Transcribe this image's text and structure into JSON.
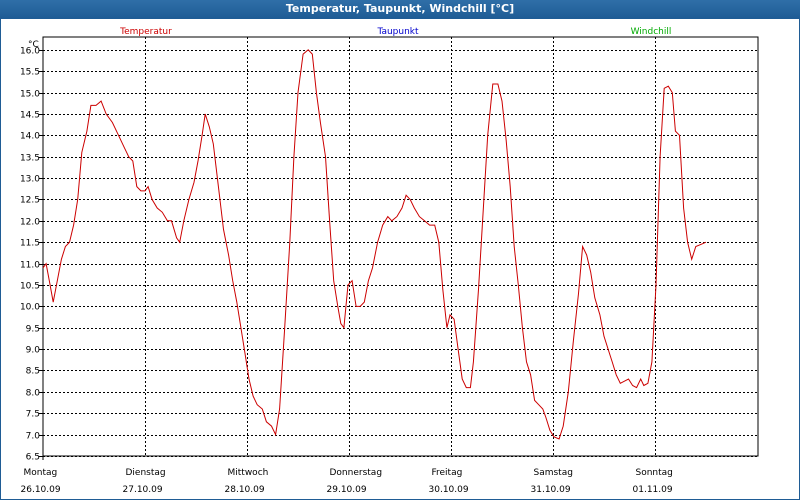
{
  "window": {
    "title": "Temperatur, Taupunkt, Windchill [°C]"
  },
  "colors": {
    "temperature": "#cc0000",
    "dewpoint": "#0000cc",
    "windchill": "#00aa00",
    "titlebar": "#1f5c95"
  },
  "chart_data": {
    "type": "line",
    "title": "Temperatur, Taupunkt, Windchill [°C]",
    "ylabel": "°C",
    "ylim": [
      6.5,
      16.3
    ],
    "yticks": [
      6.5,
      7.0,
      7.5,
      8.0,
      8.5,
      9.0,
      9.5,
      10.0,
      10.5,
      11.0,
      11.5,
      12.0,
      12.5,
      13.0,
      13.5,
      14.0,
      14.5,
      15.0,
      15.5,
      16.0
    ],
    "xlim": [
      0,
      7
    ],
    "grid": true,
    "legend_placement": "top",
    "day_labels": [
      {
        "weekday": "Montag",
        "date": "26.10.09"
      },
      {
        "weekday": "Dienstag",
        "date": "27.10.09"
      },
      {
        "weekday": "Mittwoch",
        "date": "28.10.09"
      },
      {
        "weekday": "Donnerstag",
        "date": "29.10.09"
      },
      {
        "weekday": "Freitag",
        "date": "30.10.09"
      },
      {
        "weekday": "Samstag",
        "date": "31.10.09"
      },
      {
        "weekday": "Sonntag",
        "date": "01.11.09"
      }
    ],
    "series": [
      {
        "name": "Temperatur",
        "color": "#cc0000",
        "points": [
          [
            0.0,
            10.9
          ],
          [
            0.03,
            11.0
          ],
          [
            0.07,
            10.5
          ],
          [
            0.1,
            10.1
          ],
          [
            0.14,
            10.6
          ],
          [
            0.18,
            11.1
          ],
          [
            0.22,
            11.4
          ],
          [
            0.26,
            11.5
          ],
          [
            0.3,
            11.9
          ],
          [
            0.34,
            12.5
          ],
          [
            0.38,
            13.6
          ],
          [
            0.43,
            14.1
          ],
          [
            0.47,
            14.7
          ],
          [
            0.52,
            14.7
          ],
          [
            0.57,
            14.8
          ],
          [
            0.62,
            14.5
          ],
          [
            0.68,
            14.3
          ],
          [
            0.74,
            14.0
          ],
          [
            0.8,
            13.7
          ],
          [
            0.84,
            13.5
          ],
          [
            0.88,
            13.4
          ],
          [
            0.92,
            12.8
          ],
          [
            0.96,
            12.7
          ],
          [
            1.0,
            12.7
          ],
          [
            1.03,
            12.8
          ],
          [
            1.07,
            12.5
          ],
          [
            1.12,
            12.3
          ],
          [
            1.17,
            12.2
          ],
          [
            1.22,
            12.0
          ],
          [
            1.26,
            12.0
          ],
          [
            1.31,
            11.6
          ],
          [
            1.34,
            11.5
          ],
          [
            1.38,
            12.0
          ],
          [
            1.43,
            12.5
          ],
          [
            1.48,
            12.9
          ],
          [
            1.52,
            13.4
          ],
          [
            1.56,
            14.0
          ],
          [
            1.59,
            14.5
          ],
          [
            1.63,
            14.2
          ],
          [
            1.67,
            13.8
          ],
          [
            1.72,
            12.8
          ],
          [
            1.77,
            11.8
          ],
          [
            1.82,
            11.2
          ],
          [
            1.86,
            10.6
          ],
          [
            1.9,
            10.1
          ],
          [
            1.94,
            9.5
          ],
          [
            1.98,
            8.9
          ],
          [
            2.02,
            8.3
          ],
          [
            2.06,
            7.9
          ],
          [
            2.1,
            7.7
          ],
          [
            2.15,
            7.6
          ],
          [
            2.19,
            7.3
          ],
          [
            2.24,
            7.2
          ],
          [
            2.28,
            7.0
          ],
          [
            2.32,
            7.6
          ],
          [
            2.37,
            9.5
          ],
          [
            2.42,
            11.5
          ],
          [
            2.46,
            13.5
          ],
          [
            2.5,
            15.0
          ],
          [
            2.55,
            15.9
          ],
          [
            2.6,
            16.0
          ],
          [
            2.64,
            15.9
          ],
          [
            2.68,
            15.0
          ],
          [
            2.72,
            14.3
          ],
          [
            2.77,
            13.5
          ],
          [
            2.81,
            12.0
          ],
          [
            2.85,
            10.6
          ],
          [
            2.89,
            10.0
          ],
          [
            2.92,
            9.6
          ],
          [
            2.95,
            9.5
          ],
          [
            2.99,
            10.5
          ],
          [
            3.03,
            10.6
          ],
          [
            3.07,
            10.0
          ],
          [
            3.11,
            10.0
          ],
          [
            3.15,
            10.1
          ],
          [
            3.19,
            10.6
          ],
          [
            3.23,
            10.9
          ],
          [
            3.28,
            11.5
          ],
          [
            3.33,
            11.9
          ],
          [
            3.38,
            12.1
          ],
          [
            3.42,
            12.0
          ],
          [
            3.47,
            12.1
          ],
          [
            3.52,
            12.3
          ],
          [
            3.56,
            12.6
          ],
          [
            3.6,
            12.5
          ],
          [
            3.64,
            12.3
          ],
          [
            3.69,
            12.1
          ],
          [
            3.74,
            12.0
          ],
          [
            3.79,
            11.9
          ],
          [
            3.84,
            11.9
          ],
          [
            3.88,
            11.5
          ],
          [
            3.92,
            10.4
          ],
          [
            3.96,
            9.5
          ],
          [
            3.99,
            9.8
          ],
          [
            4.03,
            9.7
          ],
          [
            4.07,
            9.0
          ],
          [
            4.11,
            8.3
          ],
          [
            4.15,
            8.1
          ],
          [
            4.19,
            8.1
          ],
          [
            4.22,
            8.7
          ],
          [
            4.27,
            10.4
          ],
          [
            4.31,
            12.0
          ],
          [
            4.36,
            14.0
          ],
          [
            4.41,
            15.2
          ],
          [
            4.46,
            15.2
          ],
          [
            4.5,
            14.8
          ],
          [
            4.54,
            13.9
          ],
          [
            4.58,
            12.8
          ],
          [
            4.62,
            11.4
          ],
          [
            4.66,
            10.5
          ],
          [
            4.7,
            9.5
          ],
          [
            4.74,
            8.7
          ],
          [
            4.78,
            8.4
          ],
          [
            4.82,
            7.8
          ],
          [
            4.86,
            7.7
          ],
          [
            4.9,
            7.6
          ],
          [
            4.93,
            7.4
          ],
          [
            4.97,
            7.1
          ],
          [
            5.01,
            6.95
          ],
          [
            5.06,
            6.9
          ],
          [
            5.1,
            7.2
          ],
          [
            5.15,
            8.0
          ],
          [
            5.2,
            9.2
          ],
          [
            5.25,
            10.3
          ],
          [
            5.29,
            11.4
          ],
          [
            5.33,
            11.2
          ],
          [
            5.37,
            10.8
          ],
          [
            5.41,
            10.2
          ],
          [
            5.46,
            9.8
          ],
          [
            5.5,
            9.3
          ],
          [
            5.54,
            9.0
          ],
          [
            5.58,
            8.7
          ],
          [
            5.62,
            8.4
          ],
          [
            5.66,
            8.2
          ],
          [
            5.7,
            8.25
          ],
          [
            5.74,
            8.3
          ],
          [
            5.78,
            8.15
          ],
          [
            5.82,
            8.1
          ],
          [
            5.86,
            8.3
          ],
          [
            5.89,
            8.15
          ],
          [
            5.93,
            8.2
          ],
          [
            5.97,
            8.7
          ],
          [
            6.01,
            10.5
          ],
          [
            6.05,
            13.5
          ],
          [
            6.09,
            15.1
          ],
          [
            6.13,
            15.15
          ],
          [
            6.17,
            15.0
          ],
          [
            6.2,
            14.1
          ],
          [
            6.24,
            14.0
          ],
          [
            6.28,
            12.3
          ],
          [
            6.32,
            11.5
          ],
          [
            6.36,
            11.1
          ],
          [
            6.4,
            11.4
          ],
          [
            6.45,
            11.45
          ],
          [
            6.5,
            11.5
          ]
        ]
      },
      {
        "name": "Taupunkt",
        "color": "#0000cc",
        "points": []
      },
      {
        "name": "Windchill",
        "color": "#00aa00",
        "points": []
      }
    ]
  }
}
